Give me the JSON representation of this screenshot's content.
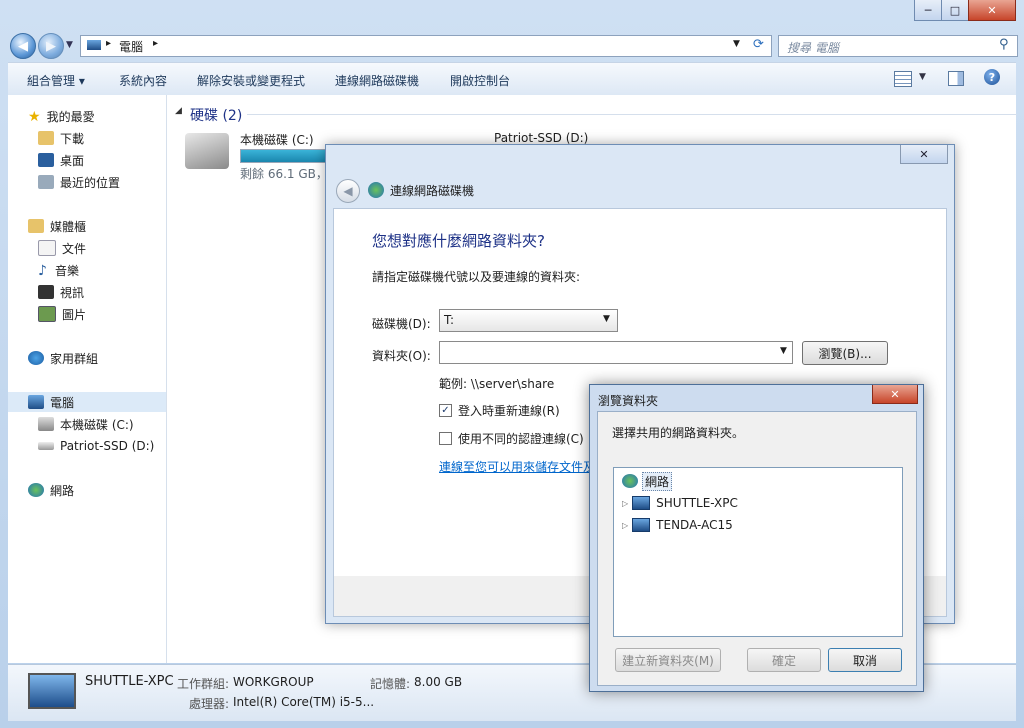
{
  "window": {
    "address": {
      "crumb": "電腦"
    },
    "search_placeholder": "搜尋 電腦",
    "caption_buttons": {
      "minimize": "─",
      "maximize": "□",
      "close": "✕"
    }
  },
  "toolbar": {
    "items": [
      "組合管理 ▾",
      "系統內容",
      "解除安裝或變更程式",
      "連線網路磁碟機",
      "開啟控制台"
    ]
  },
  "nav": {
    "favorites": {
      "label": "我的最愛",
      "items": [
        "下載",
        "桌面",
        "最近的位置"
      ]
    },
    "libraries": {
      "label": "媒體櫃",
      "items": [
        "文件",
        "音樂",
        "視訊",
        "圖片"
      ]
    },
    "homegroup": "家用群組",
    "computer": {
      "label": "電腦",
      "items": [
        "本機磁碟 (C:)",
        "Patriot-SSD (D:)"
      ]
    },
    "network": "網路"
  },
  "content": {
    "group_header": "硬碟 (2)",
    "drives": [
      {
        "name": "本機磁碟 (C:)",
        "free": "剩餘 66.1 GB，",
        "fill": 0.55
      },
      {
        "name": "Patriot-SSD (D:)"
      }
    ]
  },
  "details": {
    "name": "SHUTTLE-XPC",
    "workgroup_label": "工作群組:",
    "workgroup": "WORKGROUP",
    "memory_label": "記憶體:",
    "memory": "8.00 GB",
    "cpu_label": "處理器:",
    "cpu": "Intel(R) Core(TM) i5-5..."
  },
  "map_dialog": {
    "title": "連線網路磁碟機",
    "heading": "您想對應什麼網路資料夾?",
    "instruction": "請指定磁碟機代號以及要連線的資料夾:",
    "drive_label": "磁碟機(D):",
    "drive_value": "T:",
    "folder_label": "資料夾(O):",
    "folder_value": "",
    "browse_button": "瀏覽(B)...",
    "example": "範例: \\\\server\\share",
    "reconnect_label": "登入時重新連線(R)",
    "reconnect_checked": true,
    "diffcred_label": "使用不同的認證連線(C)",
    "diffcred_checked": false,
    "link": "連線至您可以用來儲存文件及"
  },
  "browse_dialog": {
    "title": "瀏覽資料夾",
    "close": "✕",
    "instruction": "選擇共用的網路資料夾。",
    "tree": [
      {
        "label": "網路",
        "level": 0,
        "selected": true
      },
      {
        "label": "SHUTTLE-XPC",
        "level": 1
      },
      {
        "label": "TENDA-AC15",
        "level": 1
      }
    ],
    "buttons": {
      "new_folder": "建立新資料夾(M)",
      "ok": "確定",
      "cancel": "取消"
    }
  },
  "colors": {
    "link": "#0066cc",
    "heading": "#1e3287",
    "accent": "#3399ff"
  }
}
